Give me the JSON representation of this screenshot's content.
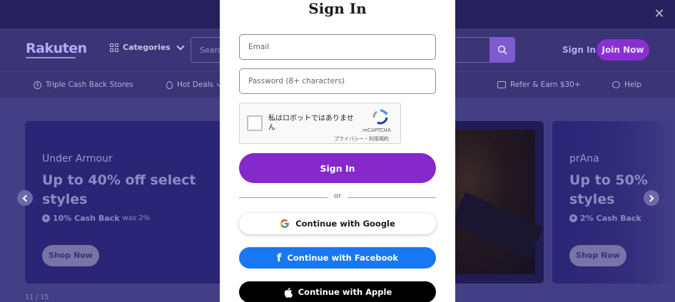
{
  "promo_bar": {
    "close_icon": "close-icon"
  },
  "header": {
    "logo": "Rakuten",
    "categories_label": "Categories",
    "search_placeholder": "Search",
    "signin_label": "Sign In",
    "join_label": "Join Now"
  },
  "subnav": {
    "items": [
      {
        "label": "Triple Cash Back Stores",
        "icon": "dollar-circle-icon"
      },
      {
        "label": "Hot Deals",
        "icon": "flame-icon"
      },
      {
        "label": "Refer & Earn $30+",
        "icon": "card-icon"
      },
      {
        "label": "Help",
        "icon": "chat-bubble-icon"
      }
    ]
  },
  "carousel": {
    "cards": [
      {
        "brand": "Under Armour",
        "deal": "Up to 40% off select styles",
        "cash_back": "10% Cash Back",
        "was": "was 2%",
        "button": "Shop Now"
      },
      {
        "brand": "prAna",
        "deal": "Up to 50% styles",
        "cash_back": "2% Cash Back",
        "button": "Shop Now"
      }
    ],
    "pager": "11 / 15"
  },
  "modal": {
    "title": "Sign In",
    "email_placeholder": "Email",
    "password_placeholder": "Password (8+ characters)",
    "captcha": {
      "text": "私はロボットではありません",
      "brand": "reCAPTCHA",
      "links": "プライバシー・利用規約"
    },
    "signin_button": "Sign In",
    "or_text": "or",
    "google_button": "Continue with Google",
    "facebook_button": "Continue with Facebook",
    "apple_button": "Continue with Apple"
  },
  "colors": {
    "primary": "#8529cd",
    "facebook": "#1877f2",
    "apple": "#000000",
    "navy": "#26215c"
  }
}
